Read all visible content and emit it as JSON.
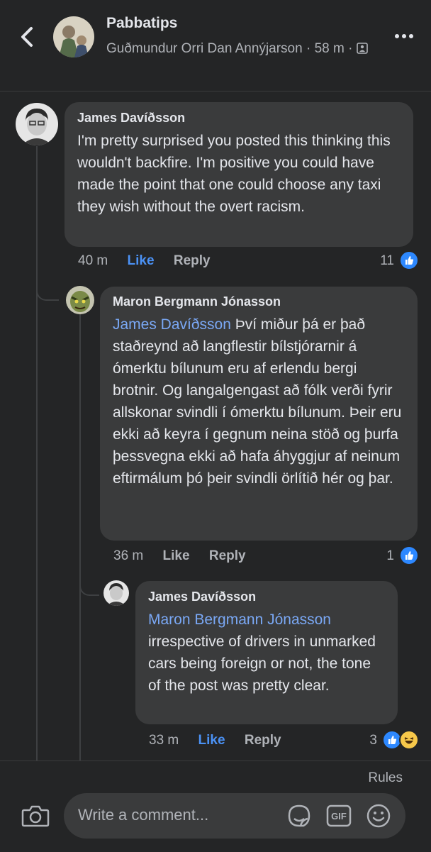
{
  "header": {
    "title": "Pabbatips",
    "subtitle_author": "Guðmundur Orri Dan Annýjarson",
    "subtitle_time": "58 m",
    "back_icon": "back-arrow-icon",
    "more_icon": "more-dots-icon"
  },
  "comments": [
    {
      "author": "James Davíðsson",
      "text": "I'm pretty surprised you posted this thinking this wouldn't backfire. I'm positive you could have made the point that one could choose any taxi they wish without the overt racism.",
      "time": "40 m",
      "like_label": "Like",
      "reply_label": "Reply",
      "reaction_count": "11"
    },
    {
      "author": "Maron Bergmann Jónasson",
      "mention": "James Davíðsson",
      "text": "Því miður þá er það staðreynd að langflestir bílstjórarnir á ómerktu bílunum eru af erlendu bergi brotnir.  Og langalgengast að fólk verði fyrir allskonar svindli í ómerktu bílunum.  Þeir eru ekki að keyra í gegnum neina stöð og þurfa þessvegna ekki að hafa áhyggjur af neinum eftirmálum þó þeir svindli örlítið hér og þar.",
      "time": "36 m",
      "like_label": "Like",
      "reply_label": "Reply",
      "reaction_count": "1"
    },
    {
      "author": "James Davíðsson",
      "mention": "Maron Bergmann Jónasson",
      "text": "irrespective of drivers in unmarked cars being foreign or not, the tone of the post was pretty clear.",
      "time": "33 m",
      "like_label": "Like",
      "reply_label": "Reply",
      "reaction_count": "3"
    }
  ],
  "footer": {
    "rules_label": "Rules",
    "comment_placeholder": "Write a comment...",
    "icons": [
      "camera-icon",
      "sticker-icon",
      "gif-icon",
      "emoji-icon"
    ]
  },
  "colors": {
    "background": "#242526",
    "bubble": "#3a3b3c",
    "accent": "#4b92f5",
    "mention": "#7aa8f5"
  }
}
